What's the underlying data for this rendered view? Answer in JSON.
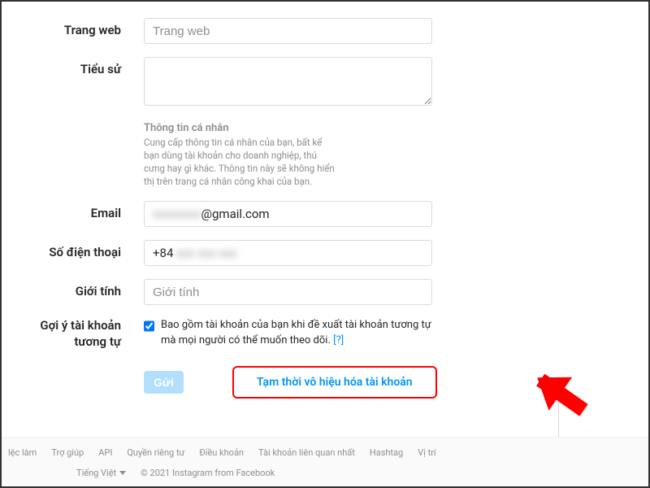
{
  "form": {
    "website_label": "Trang web",
    "website_placeholder": "Trang web",
    "website_value": "",
    "bio_label": "Tiểu sử",
    "bio_value": "",
    "personal_info_header": "Thông tin cá nhân",
    "personal_info_desc": "Cung cấp thông tin cá nhân của bạn, bất kể bạn dùng tài khoản cho doanh nghiệp, thú cưng hay gì khác. Thông tin này sẽ không hiển thị trên trang cá nhân công khai của bạn.",
    "email_label": "Email",
    "email_value_masked": "xxxxxxxx",
    "email_value_domain": "@gmail.com",
    "phone_label": "Số điện thoại",
    "phone_value_prefix": "+84",
    "phone_value_masked": "xxx xxx xxx",
    "gender_label": "Giới tính",
    "gender_placeholder": "Giới tính",
    "gender_value": "",
    "suggestion_label_line1": "Gợi ý tài khoản",
    "suggestion_label_line2": "tương tự",
    "suggestion_checkbox_label": "Bao gồm tài khoản của bạn khi đề xuất tài khoản tương tự mà mọi người có thể muốn theo dõi.",
    "suggestion_help": "[?]",
    "submit_button": "Gửi",
    "deactivate_link": "Tạm thời vô hiệu hóa tài khoản"
  },
  "footer": {
    "links": [
      "lệc làm",
      "Trợ giúp",
      "API",
      "Quyền riêng tư",
      "Điều khoản",
      "Tài khoản liên quan nhất",
      "Hashtag",
      "Vị trí"
    ],
    "language": "Tiếng Việt",
    "copyright": "© 2021 Instagram from Facebook"
  }
}
